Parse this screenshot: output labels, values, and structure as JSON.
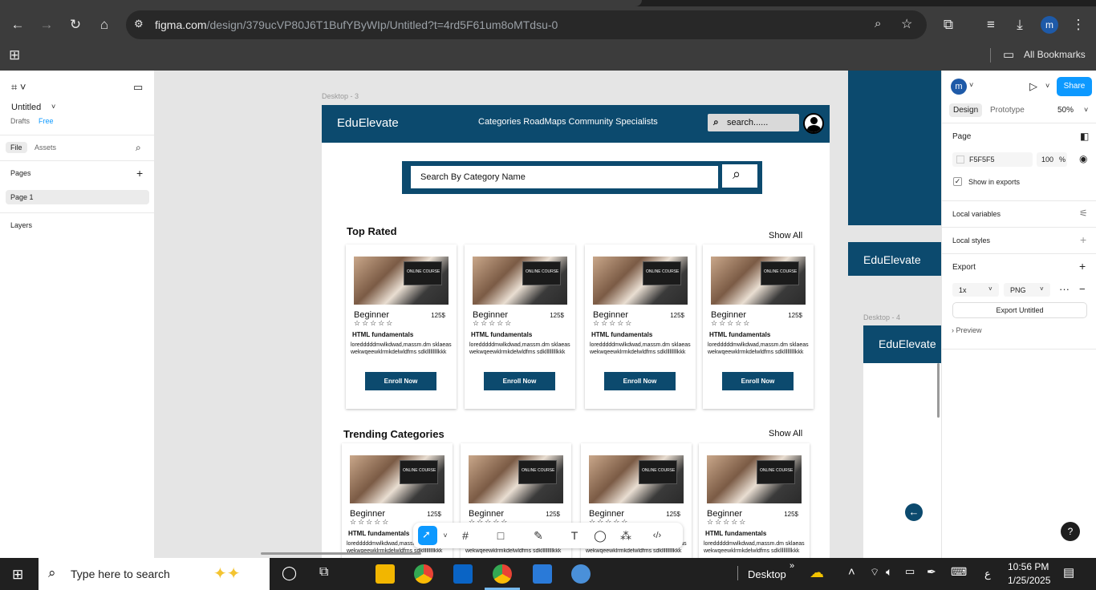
{
  "browser": {
    "url_host": "figma.com",
    "url_path": "/design/379ucVP80J6T1BufYByWIp/Untitled?t=4rd5F61um8oMTdsu-0",
    "all_bookmarks": "All Bookmarks",
    "avatar_letter": "m"
  },
  "left": {
    "file_name": "Untitled",
    "drafts": "Drafts",
    "plan": "Free",
    "tab_file": "File",
    "tab_assets": "Assets",
    "pages_title": "Pages",
    "page1": "Page 1",
    "layers_title": "Layers"
  },
  "canvas": {
    "frame_label": "Desktop - 3",
    "frame4_label": "Desktop - 4",
    "logo": "EduElevate",
    "nav_links": "Categories  RoadMaps  Community Specialists",
    "header_search": "search......",
    "big_search_placeholder": "Search By Category Name",
    "top_rated": "Top Rated",
    "trending": "Trending Categories",
    "show_all": "Show All",
    "side_logo_1": "EduElevate",
    "side_logo_2": "EduElevate"
  },
  "card": {
    "level": "Beginner",
    "price": "125$",
    "stars": "☆☆☆☆☆",
    "title": "HTML fundamentals",
    "desc": "loredddddmwlkdwad,massm.dm sklaeaswekwqeewklrmkdelwldfms sdklllllllllkkk",
    "enroll": "Enroll Now",
    "image_text": "ONLINE COURSE"
  },
  "right": {
    "share": "Share",
    "tab_design": "Design",
    "tab_prototype": "Prototype",
    "zoom": "50%",
    "page_title": "Page",
    "bg_hex": "F5F5F5",
    "opacity": "100",
    "percent": "%",
    "show_in_exports": "Show in exports",
    "local_variables": "Local variables",
    "local_styles": "Local styles",
    "export": "Export",
    "scale": "1x",
    "format": "PNG",
    "export_btn": "Export Untitled",
    "preview": "Preview",
    "help": "?"
  },
  "taskbar": {
    "search_placeholder": "Type here to search",
    "desktop": "Desktop",
    "time": "10:56 PM",
    "date": "1/25/2025",
    "lang": "ع"
  },
  "colors": {
    "brand": "#0c4a6e",
    "figma_blue": "#0d99ff"
  }
}
